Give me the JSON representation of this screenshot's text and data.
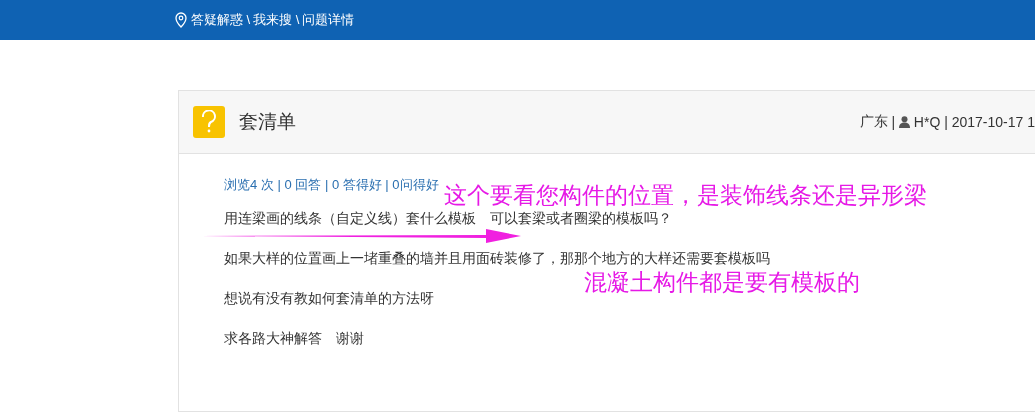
{
  "breadcrumb": [
    "答疑解惑 \\",
    "我来搜 \\",
    "问题详情"
  ],
  "question": {
    "title": "套清单",
    "region": "广东",
    "separator": "|",
    "author": "H*Q",
    "date": "2017-10-17 1",
    "stats": "浏览4 次 | 0 回答 | 0 答得好 | 0问得好",
    "paragraphs": [
      "用连梁画的线条（自定义线）套什么模板　可以套梁或者圈梁的模板吗？",
      "如果大样的位置画上一堵重叠的墙并且用面砖装修了，那那个地方的大样还需要套模板吗",
      "想说有没有教如何套清单的方法呀",
      "求各路大神解答　谢谢"
    ]
  },
  "annotations": [
    "这个要看您构件的位置，是装饰线条还是异形梁",
    "混凝土构件都是要有模板的"
  ]
}
